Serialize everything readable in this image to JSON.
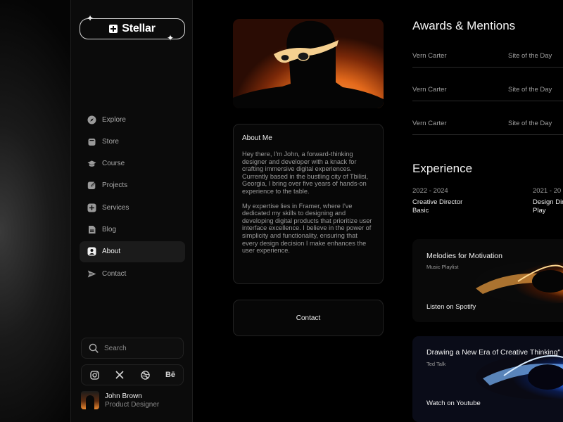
{
  "brand": {
    "name": "Stellar"
  },
  "nav": {
    "items": [
      {
        "label": "Explore",
        "icon": "compass-icon"
      },
      {
        "label": "Store",
        "icon": "store-icon"
      },
      {
        "label": "Course",
        "icon": "graduation-cap-icon"
      },
      {
        "label": "Projects",
        "icon": "edit-icon"
      },
      {
        "label": "Services",
        "icon": "plus-square-icon"
      },
      {
        "label": "Blog",
        "icon": "document-icon"
      },
      {
        "label": "About",
        "icon": "user-icon",
        "active": true
      },
      {
        "label": "Contact",
        "icon": "send-icon"
      }
    ]
  },
  "search": {
    "placeholder": "Search"
  },
  "social": {
    "behance_label": "Bē"
  },
  "profile": {
    "name": "John Brown",
    "role": "Product Designer"
  },
  "about": {
    "title": "About Me",
    "paragraph1": "Hey there, I'm John, a forward-thinking designer and developer with a knack for crafting immersive digital experiences. Currently based in the bustling city of Tbilisi, Georgia, I bring over five years of hands-on experience to the table.",
    "paragraph2": "My expertise lies in Framer, where I've dedicated my skills to designing and developing digital products that prioritize user interface excellence. I believe in the power of simplicity and functionality, ensuring that every design decision I make enhances the user experience."
  },
  "contact": {
    "label": "Contact"
  },
  "awards": {
    "title": "Awards & Mentions",
    "rows": [
      {
        "name": "Vern Carter",
        "award": "Site of the Day"
      },
      {
        "name": "Vern Carter",
        "award": "Site of the Day"
      },
      {
        "name": "Vern Carter",
        "award": "Site of the Day"
      }
    ]
  },
  "experience": {
    "title": "Experience",
    "items": [
      {
        "years": "2022 - 2024",
        "role": "Creative Director",
        "company": "Basic"
      },
      {
        "years": "2021 - 20",
        "role": "Design Dir",
        "company": "Play"
      }
    ]
  },
  "cards": [
    {
      "title": "Melodies for Motivation",
      "subtitle": "Music Playlist",
      "action": "Listen  on Spotify"
    },
    {
      "title": "Drawing a New Era of Creative Thinking\"",
      "subtitle": "Ted Talk",
      "action": "Watch on Youtube"
    }
  ],
  "colors": {
    "background": "#000000",
    "sidebar": "#0b0b0b",
    "accent_orange": "#e46a1c",
    "accent_blue": "#2a6bff"
  }
}
